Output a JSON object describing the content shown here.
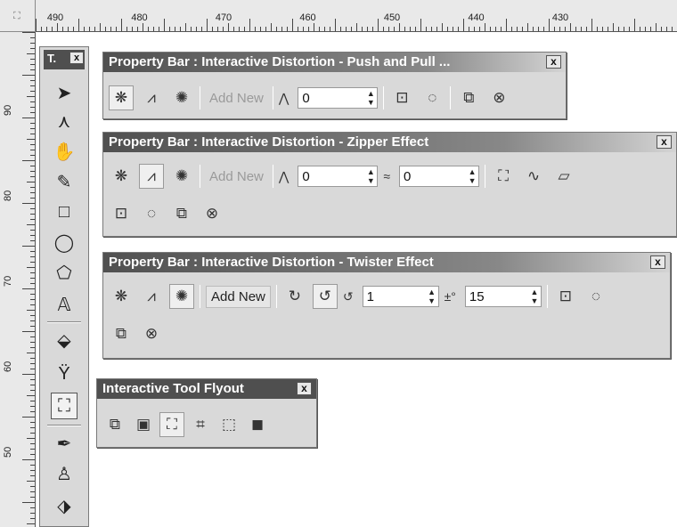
{
  "rulers": {
    "corner_glyph": "⛶",
    "horizontal_labels": [
      "490",
      "480",
      "470",
      "460",
      "450",
      "440",
      "430"
    ],
    "vertical_labels": [
      "90",
      "80",
      "70",
      "60",
      "50"
    ]
  },
  "toolbox": {
    "title": "T.",
    "close": "x",
    "tools": [
      "pick-tool",
      "shape-tool",
      "pan-tool",
      "smart-fill-tool",
      "rectangle-tool",
      "ellipse-tool",
      "polygon-tool",
      "text-tool",
      "fill-tool",
      "eyedropper-tool",
      "interactive-distortion-tool",
      "outline-pen-tool",
      "pen-tool",
      "paint-bucket-tool"
    ]
  },
  "push_pull_bar": {
    "title": "Property Bar : Interactive Distortion - Push and Pull ...",
    "close": "x",
    "add_new": "Add New",
    "amplitude": "0"
  },
  "zipper_bar": {
    "title": "Property Bar : Interactive Distortion - Zipper Effect",
    "close": "x",
    "add_new": "Add New",
    "amplitude": "0",
    "frequency": "0"
  },
  "twister_bar": {
    "title": "Property Bar : Interactive Distortion - Twister Effect",
    "close": "x",
    "add_new": "Add New",
    "rotations": "1",
    "degree_icon": "±°",
    "additional_degrees": "15"
  },
  "flyout": {
    "title": "Interactive Tool Flyout",
    "close": "x",
    "tools": [
      "blend-tool",
      "contour-tool",
      "distortion-tool",
      "envelope-tool",
      "extrude-tool",
      "drop-shadow-tool"
    ]
  },
  "colors": {
    "title_dark": "#505050",
    "panel_bg": "#d9d9d9"
  }
}
